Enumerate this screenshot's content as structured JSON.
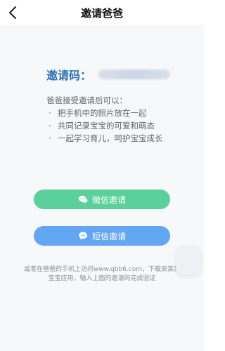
{
  "header": {
    "title": "邀请爸爸"
  },
  "invite": {
    "label": "邀请码："
  },
  "instructions": {
    "intro": "爸爸接受邀请后可以：",
    "items": [
      "把手机中的照片放在一起",
      "共同记录宝宝的可爱和萌态",
      "一起学习育儿，呵护宝宝成长"
    ]
  },
  "buttons": {
    "wechat": "微信邀请",
    "sms": "短信邀请"
  },
  "footer": {
    "note": "或者在爸爸的手机上访问www.qbb6.com，下载安装亲宝宝应用，输入上面的邀请码完成验证"
  },
  "colors": {
    "wechat_button": "#5ad19b",
    "sms_button": "#63a6f4",
    "invite_label": "#2f6fb8"
  },
  "icons": {
    "back": "chevron-left-icon",
    "wechat": "wechat-icon",
    "sms": "chat-bubble-icon"
  }
}
